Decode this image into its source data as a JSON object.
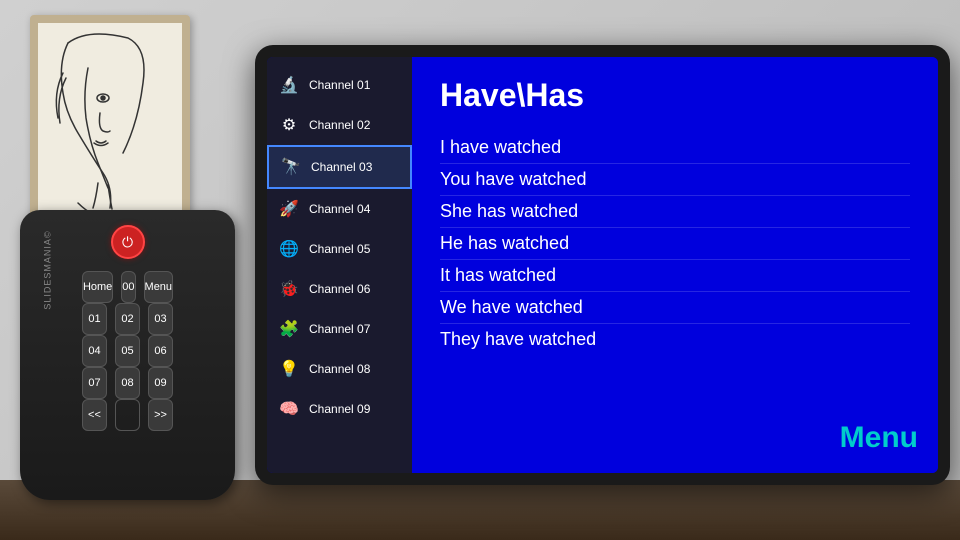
{
  "wall": {
    "background": "#c8c8c8"
  },
  "picture": {
    "alt": "Line art face sketch"
  },
  "tv": {
    "title": "Have\\Has",
    "menu_label": "Menu",
    "channels": [
      {
        "id": "01",
        "label": "Channel 01",
        "icon": "🔬",
        "active": false
      },
      {
        "id": "02",
        "label": "Channel 02",
        "icon": "⚙️",
        "active": false
      },
      {
        "id": "03",
        "label": "Channel 03",
        "icon": "🔭",
        "active": true
      },
      {
        "id": "04",
        "label": "Channel 04",
        "icon": "🚀",
        "active": false
      },
      {
        "id": "05",
        "label": "Channel 05",
        "icon": "🌐",
        "active": false
      },
      {
        "id": "06",
        "label": "Channel 06",
        "icon": "🐞",
        "active": false
      },
      {
        "id": "07",
        "label": "Channel 07",
        "icon": "🧩",
        "active": false
      },
      {
        "id": "08",
        "label": "Channel 08",
        "icon": "💡",
        "active": false
      },
      {
        "id": "09",
        "label": "Channel 09",
        "icon": "🧠",
        "active": false
      }
    ],
    "list_items": [
      "I have watched",
      "You have watched",
      "She has watched",
      "He has watched",
      "It has watched",
      "We have watched",
      "They have watched"
    ]
  },
  "remote": {
    "power_icon": "⏻",
    "rows": [
      [
        "Home",
        "00",
        "Menu"
      ],
      [
        "01",
        "02",
        "03"
      ],
      [
        "04",
        "05",
        "06"
      ],
      [
        "07",
        "08",
        "09"
      ],
      [
        "<<",
        "",
        ">>"
      ]
    ]
  },
  "branding": {
    "slides_mania": "SLIDESMANIA©"
  }
}
